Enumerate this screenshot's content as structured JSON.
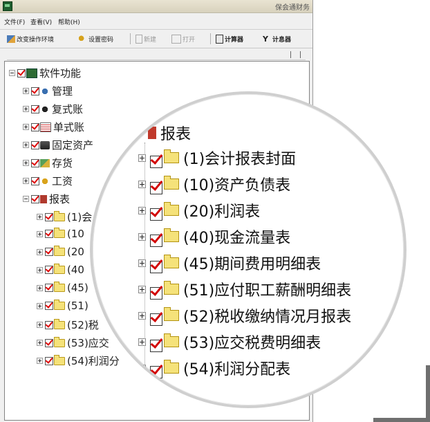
{
  "window": {
    "title": "保会通财务"
  },
  "menu": [
    {
      "label": "文件(F)"
    },
    {
      "label": "查看(V)"
    },
    {
      "label": "帮助(H)"
    }
  ],
  "toolbar": [
    {
      "label": "改变操作环境",
      "icon": "change-env-icon",
      "enabled": true
    },
    {
      "label": "设置密码",
      "icon": "key-icon",
      "enabled": true
    },
    {
      "label": "新建",
      "icon": "new-doc-icon",
      "enabled": false
    },
    {
      "label": "打开",
      "icon": "open-icon",
      "enabled": false
    },
    {
      "label": "计算器",
      "icon": "calculator-icon",
      "enabled": true
    },
    {
      "label": "计息器",
      "icon": "interest-icon",
      "enabled": true
    }
  ],
  "tree": {
    "root": "软件功能",
    "modules": [
      {
        "label": "管理",
        "icon": "manage-icon"
      },
      {
        "label": "复式账",
        "icon": "double-entry-icon"
      },
      {
        "label": "单式账",
        "icon": "single-entry-icon"
      },
      {
        "label": "固定资产",
        "icon": "fixed-asset-icon"
      },
      {
        "label": "存货",
        "icon": "inventory-icon"
      },
      {
        "label": "工资",
        "icon": "salary-icon"
      },
      {
        "label": "报表",
        "icon": "report-icon"
      }
    ],
    "reports_visible_small": [
      {
        "label": "(1)会"
      },
      {
        "label": "(10"
      },
      {
        "label": "(20"
      },
      {
        "label": "(40"
      },
      {
        "label": "(45)"
      },
      {
        "label": "(51)"
      },
      {
        "label": "(52)税"
      },
      {
        "label": "(53)应交"
      },
      {
        "label": "(54)利润分"
      }
    ]
  },
  "magnified": {
    "header": "报表",
    "items": [
      {
        "label": "(1)会计报表封面"
      },
      {
        "label": "(10)资产负债表"
      },
      {
        "label": "(20)利润表"
      },
      {
        "label": "(40)现金流量表"
      },
      {
        "label": "(45)期间费用明细表"
      },
      {
        "label": "(51)应付职工薪酬明细表"
      },
      {
        "label": "(52)税收缴纳情况月报表"
      },
      {
        "label": "(53)应交税费明细表"
      },
      {
        "label": "(54)利润分配表"
      }
    ]
  },
  "colors": {
    "check": "#d00000",
    "folder": "#f5e27a"
  }
}
